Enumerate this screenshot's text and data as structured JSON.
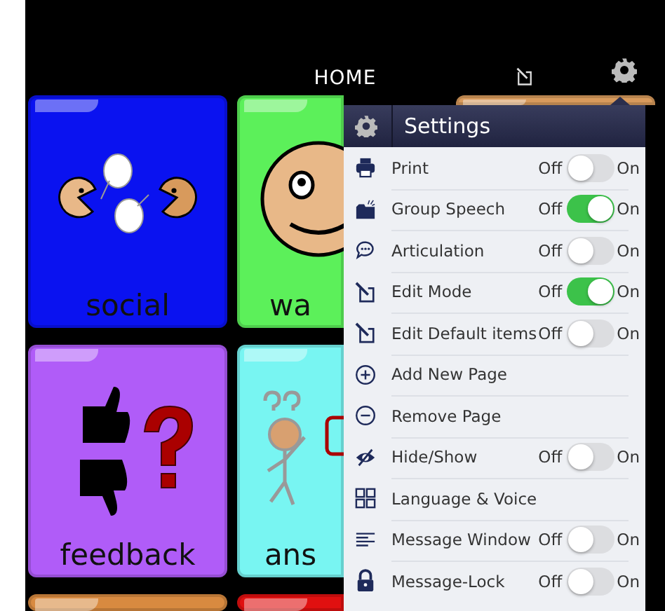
{
  "header": {
    "title": "HOME"
  },
  "tiles": [
    {
      "label": "social",
      "color": "#0a12f0"
    },
    {
      "label": "wa",
      "color": "#5cf05a"
    },
    {
      "color": "#d89a5c"
    },
    {
      "label": "feedback",
      "color": "#b05cf8"
    },
    {
      "label": "ans",
      "color": "#78f5f2"
    },
    {
      "color": "#d88a40"
    },
    {
      "color": "#e01010"
    }
  ],
  "settings": {
    "title": "Settings",
    "items": [
      {
        "kind": "toggle",
        "label": "Print",
        "off_label": "Off",
        "on_label": "On",
        "on": false
      },
      {
        "kind": "toggle",
        "label": "Group Speech",
        "off_label": "Off",
        "on_label": "On",
        "on": true
      },
      {
        "kind": "toggle",
        "label": "Articulation",
        "off_label": "Off",
        "on_label": "On",
        "on": false
      },
      {
        "kind": "toggle",
        "label": "Edit Mode",
        "off_label": "Off",
        "on_label": "On",
        "on": true
      },
      {
        "kind": "toggle",
        "label": "Edit Default items",
        "off_label": "Off",
        "on_label": "On",
        "on": false
      },
      {
        "kind": "action",
        "label": "Add New Page"
      },
      {
        "kind": "action",
        "label": "Remove Page"
      },
      {
        "kind": "toggle",
        "label": "Hide/Show",
        "off_label": "Off",
        "on_label": "On",
        "on": false
      },
      {
        "kind": "action",
        "label": "Language & Voice"
      },
      {
        "kind": "toggle",
        "label": "Message Window",
        "off_label": "Off",
        "on_label": "On",
        "on": false
      },
      {
        "kind": "toggle",
        "label": "Message-Lock",
        "off_label": "Off",
        "on_label": "On",
        "on": false
      }
    ]
  }
}
